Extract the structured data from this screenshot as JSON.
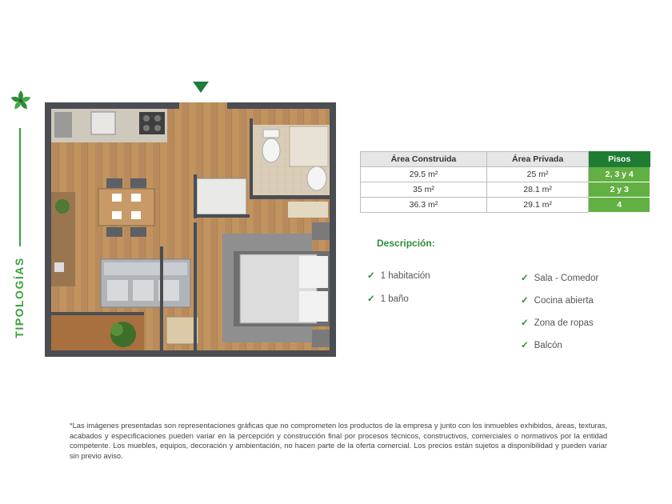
{
  "sidebar": {
    "title": "TIPOLOGÍAS",
    "icon": "leaf-star-logo-icon",
    "accent_color": "#3aa13a"
  },
  "table": {
    "headers": [
      "Área Construida",
      "Área Privada",
      "Pisos"
    ],
    "rows": [
      [
        "29.5 m²",
        "25 m²",
        "2, 3 y 4"
      ],
      [
        "35 m²",
        "28.1 m²",
        "2 y 3"
      ],
      [
        "36.3 m²",
        "29.1 m²",
        "4"
      ]
    ],
    "header_green": "#1e7d32",
    "cell_green": "#62b043"
  },
  "description": {
    "title": "Descripción:",
    "left_items": [
      "1 habitación",
      "1 baño"
    ],
    "right_items": [
      "Sala - Comedor",
      "Cocina abierta",
      "Zona de ropas",
      "Balcón"
    ],
    "check_icon": "checkmark-icon"
  },
  "disclaimer": "*Las imágenes presentadas son representaciones gráficas que no  comprometen los productos de la empresa y junto con los inmuebles exhibidos, áreas, texturas, acabados y especificaciones pueden variar en la percepción y construcción final por procesos técnicos, constructivos, comerciales o normativos por la entidad competente. Los muebles, equipos, decoración y ambientación, no hacen parte de la oferta comercial. Los precios están sujetos a disponibilidad y pueden variar sin previo aviso."
}
